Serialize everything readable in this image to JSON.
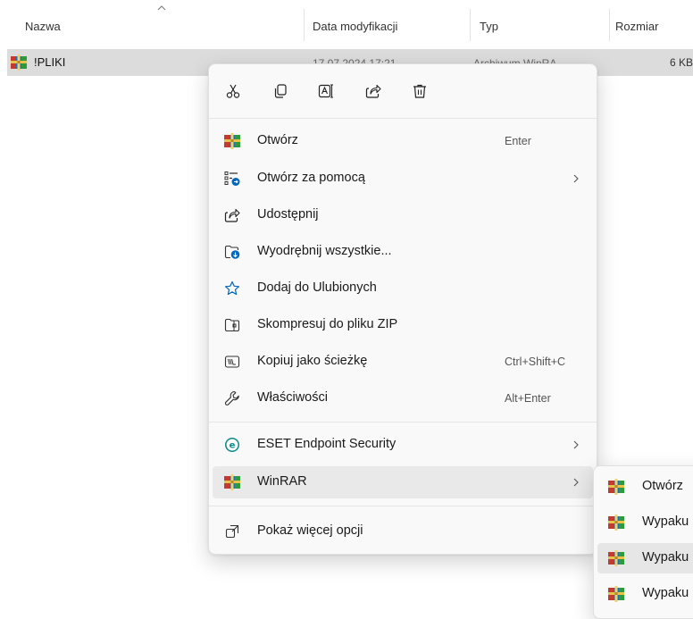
{
  "columns": {
    "name": "Nazwa",
    "modified": "Data modyfikacji",
    "type": "Typ",
    "size": "Rozmiar"
  },
  "file": {
    "name": "!PLIKI",
    "icon": "winrar-archive-icon",
    "modified": "17.07.2024 17:21",
    "type": "Archiwum WinRA",
    "size": "6 KB"
  },
  "quick_actions": [
    {
      "name": "cut",
      "icon": "scissors-icon"
    },
    {
      "name": "copy",
      "icon": "copy-icon"
    },
    {
      "name": "rename",
      "icon": "rename-icon"
    },
    {
      "name": "share",
      "icon": "share-icon"
    },
    {
      "name": "delete",
      "icon": "trash-icon"
    }
  ],
  "menu": {
    "items": [
      {
        "label": "Otwórz",
        "shortcut": "Enter",
        "icon": "winrar-icon"
      },
      {
        "label": "Otwórz za pomocą",
        "icon": "open-with-icon",
        "submenu": true
      },
      {
        "label": "Udostępnij",
        "icon": "share-icon"
      },
      {
        "label": "Wyodrębnij wszystkie...",
        "icon": "extract-icon"
      },
      {
        "label": "Dodaj do Ulubionych",
        "icon": "star-icon"
      },
      {
        "label": "Skompresuj do pliku ZIP",
        "icon": "zip-folder-icon"
      },
      {
        "label": "Kopiuj jako ścieżkę",
        "shortcut": "Ctrl+Shift+C",
        "icon": "copy-path-icon"
      },
      {
        "label": "Właściwości",
        "shortcut": "Alt+Enter",
        "icon": "wrench-icon"
      },
      {
        "label": "ESET Endpoint Security",
        "icon": "eset-icon",
        "submenu": true
      },
      {
        "label": "WinRAR",
        "icon": "winrar-icon",
        "submenu": true
      },
      {
        "label": "Pokaż więcej opcji",
        "icon": "more-options-icon"
      }
    ]
  },
  "submenu": {
    "items": [
      {
        "label": "Otwórz"
      },
      {
        "label": "Wypaku"
      },
      {
        "label": "Wypaku"
      },
      {
        "label": "Wypaku"
      }
    ]
  },
  "colors": {
    "accent": "#0067c0",
    "selection": "#dcdcdc",
    "menu_bg": "#f9f9f9",
    "hover": "#e9e9e9"
  }
}
